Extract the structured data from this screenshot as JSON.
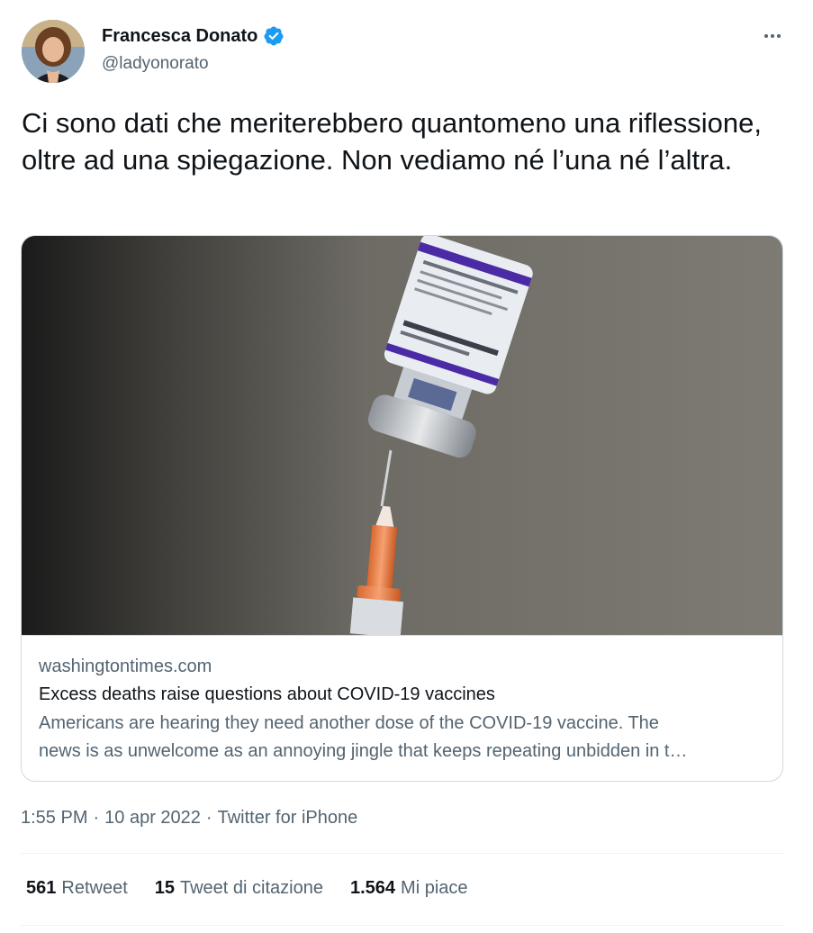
{
  "author": {
    "display_name": "Francesca Donato",
    "handle": "@ladyonorato",
    "verified": true,
    "verified_icon": "verified-badge-icon",
    "verified_color": "#1d9bf0"
  },
  "more_icon": "more-horizontal-icon",
  "tweet": {
    "text": "Ci sono dati che meriterebbero quantomeno una riflessione, oltre ad una spiegazione. Non vediamo né l’una né l’altra."
  },
  "card": {
    "image_label": "vaccine vial and syringe photo",
    "domain": "washingtontimes.com",
    "title": "Excess deaths raise questions about COVID-19 vaccines",
    "description_line1": "Americans are hearing they need another dose of the COVID-19 vaccine. The",
    "description_line2": "news is as unwelcome as an annoying jingle that keeps repeating unbidden in t…"
  },
  "meta": {
    "time": "1:55 PM",
    "dot1": "·",
    "date": "10 apr 2022",
    "dot2": "·",
    "source": "Twitter for iPhone"
  },
  "stats": {
    "retweets_count": "561",
    "retweets_label": "Retweet",
    "quotes_count": "15",
    "quotes_label": "Tweet di citazione",
    "likes_count": "1.564",
    "likes_label": "Mi piace"
  }
}
